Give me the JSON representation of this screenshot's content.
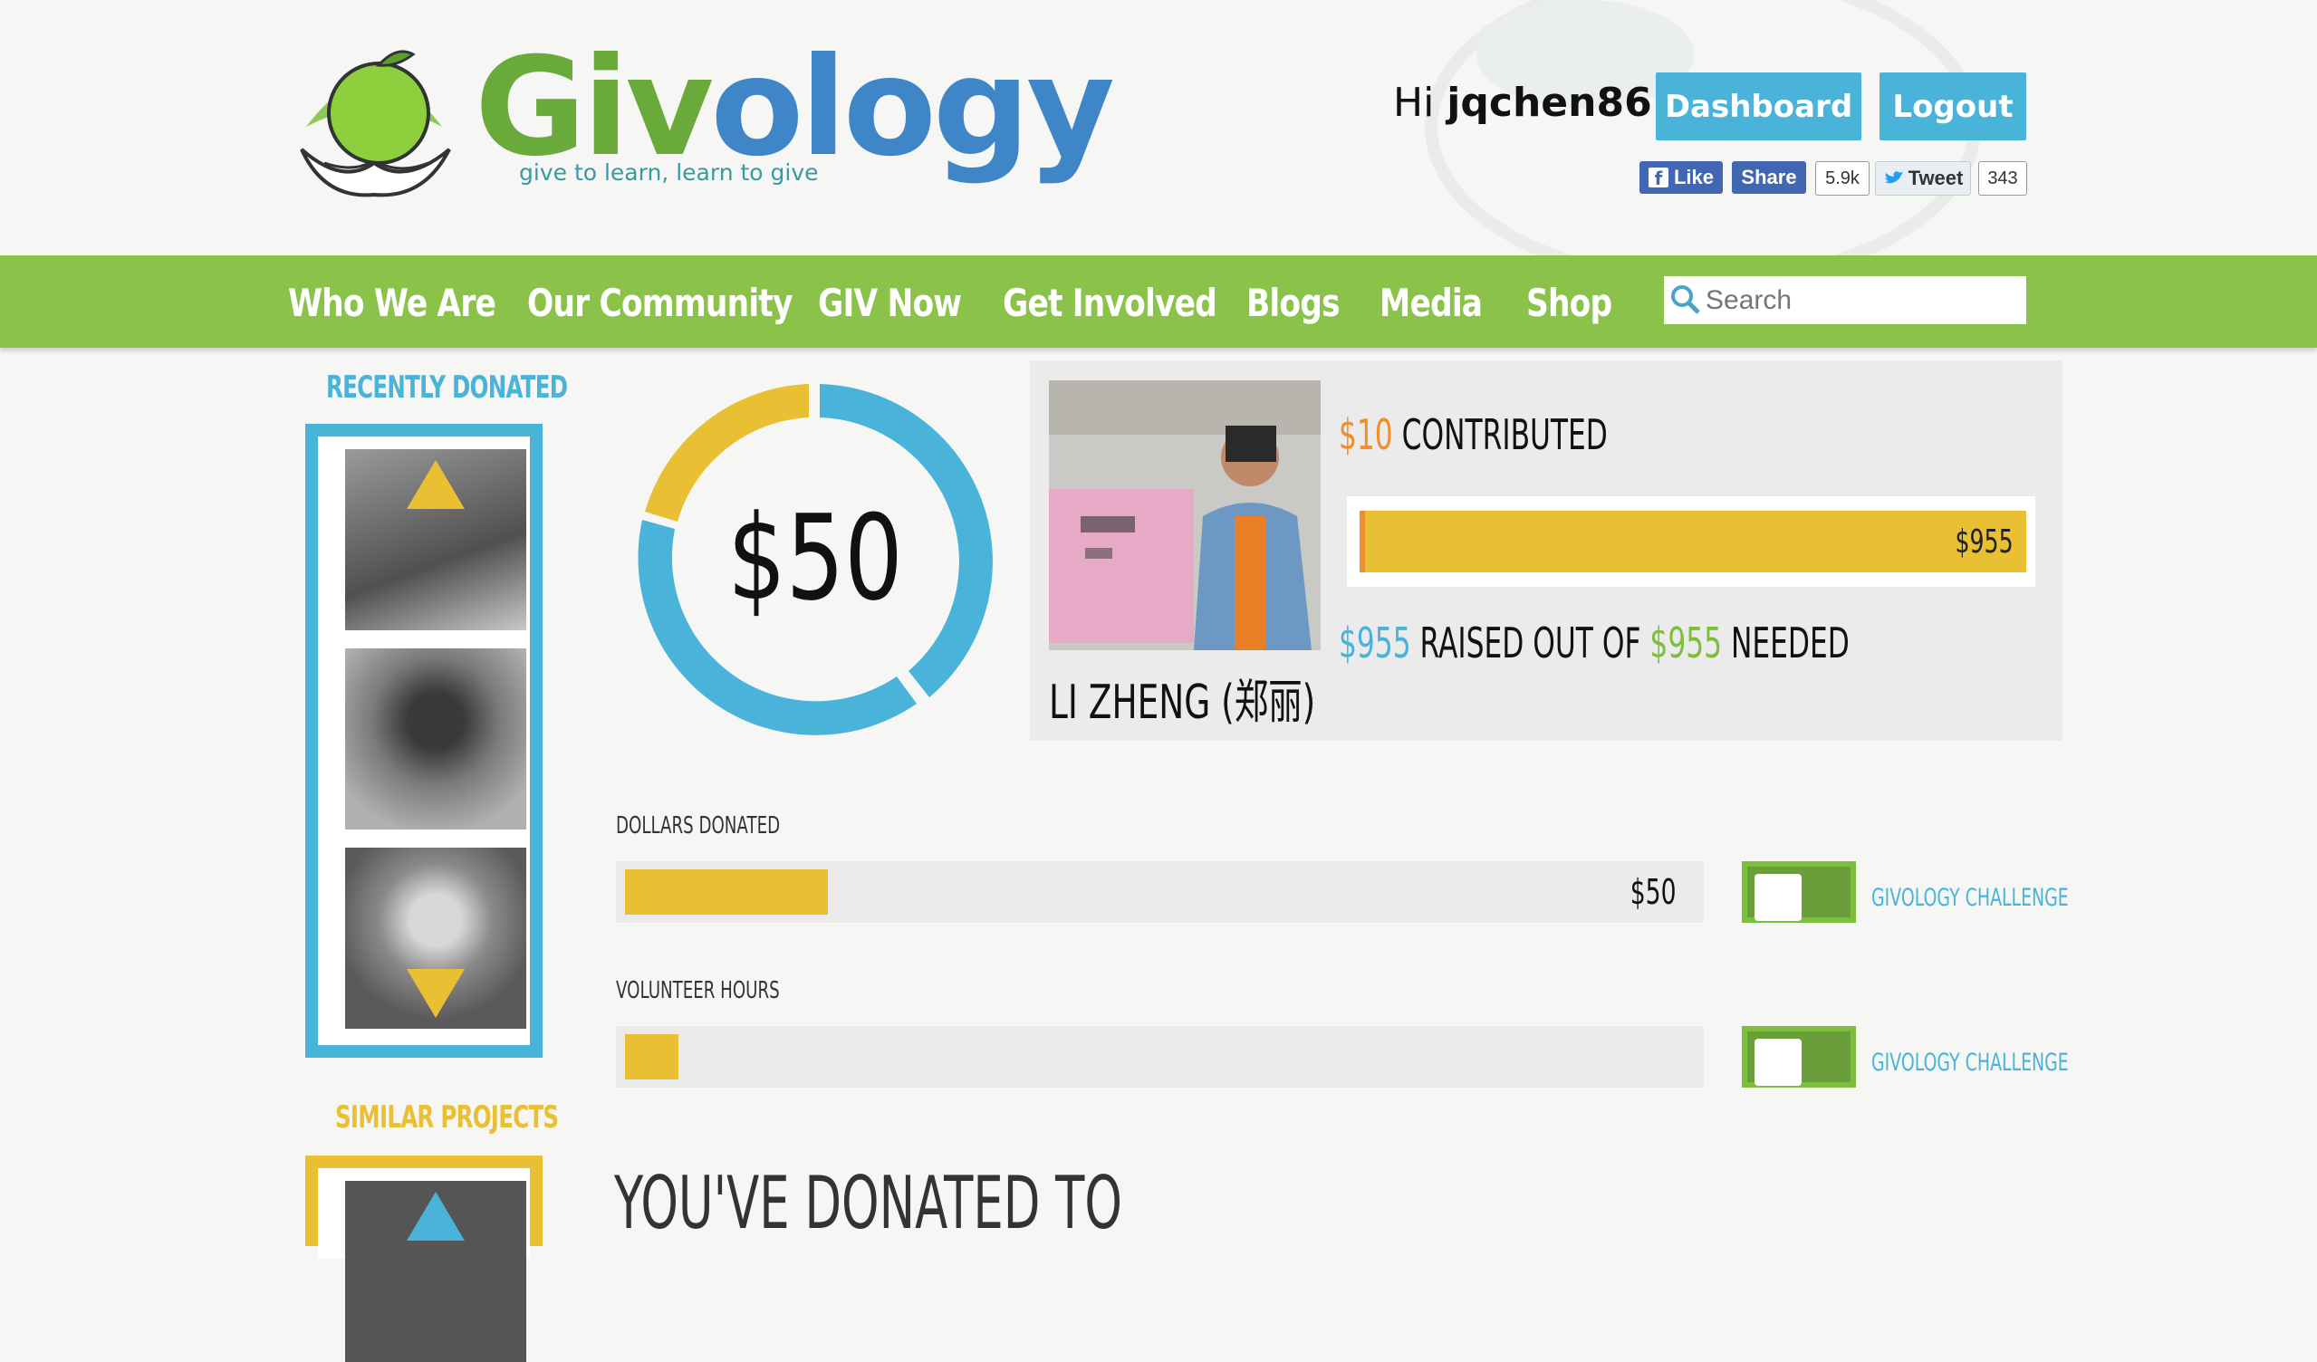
{
  "brand": {
    "name_part1": "Giv",
    "name_part2": "ology",
    "tagline": "give to learn, learn to give"
  },
  "header": {
    "greeting_prefix": "Hi ",
    "username": "jqchen86!",
    "dashboard_label": "Dashboard",
    "logout_label": "Logout"
  },
  "social": {
    "like_label": "Like",
    "share_label": "Share",
    "share_count": "5.9k",
    "tweet_label": "Tweet",
    "tweet_count": "343"
  },
  "nav": {
    "items": [
      "Who We Are",
      "Our Community",
      "GIV Now",
      "Get Involved",
      "Blogs",
      "Media",
      "Shop"
    ],
    "search_placeholder": "Search"
  },
  "sidebar": {
    "recently_donated_title": "RECENTLY DONATED",
    "similar_projects_title": "SIMILAR PROJECTS"
  },
  "donut": {
    "label": "$50",
    "colors": {
      "primary": "#49b3d9",
      "secondary": "#e9bf34"
    }
  },
  "project": {
    "name": "LI ZHENG (郑丽)",
    "contributed_amount": "$10",
    "contributed_text": " CONTRIBUTED",
    "goal_bar_label": "$955",
    "goal_progress": 1.0,
    "raised_amount": "$955",
    "raised_text_mid": " RAISED OUT OF ",
    "needed_amount": "$955",
    "needed_text": " NEEDED"
  },
  "stats": {
    "dollars_title": "DOLLARS DONATED",
    "dollars_value": "$50",
    "dollars_progress": 0.19,
    "hours_title": "VOLUNTEER HOURS",
    "hours_progress": 0.05,
    "challenge_label": "GIVOLOGY CHALLENGE"
  },
  "donated_heading": "YOU'VE DONATED TO",
  "colors": {
    "nav_green": "#8bc34a",
    "accent_blue": "#49b3d9",
    "accent_yellow": "#e9bf34",
    "accent_orange": "#ef8f2c"
  }
}
